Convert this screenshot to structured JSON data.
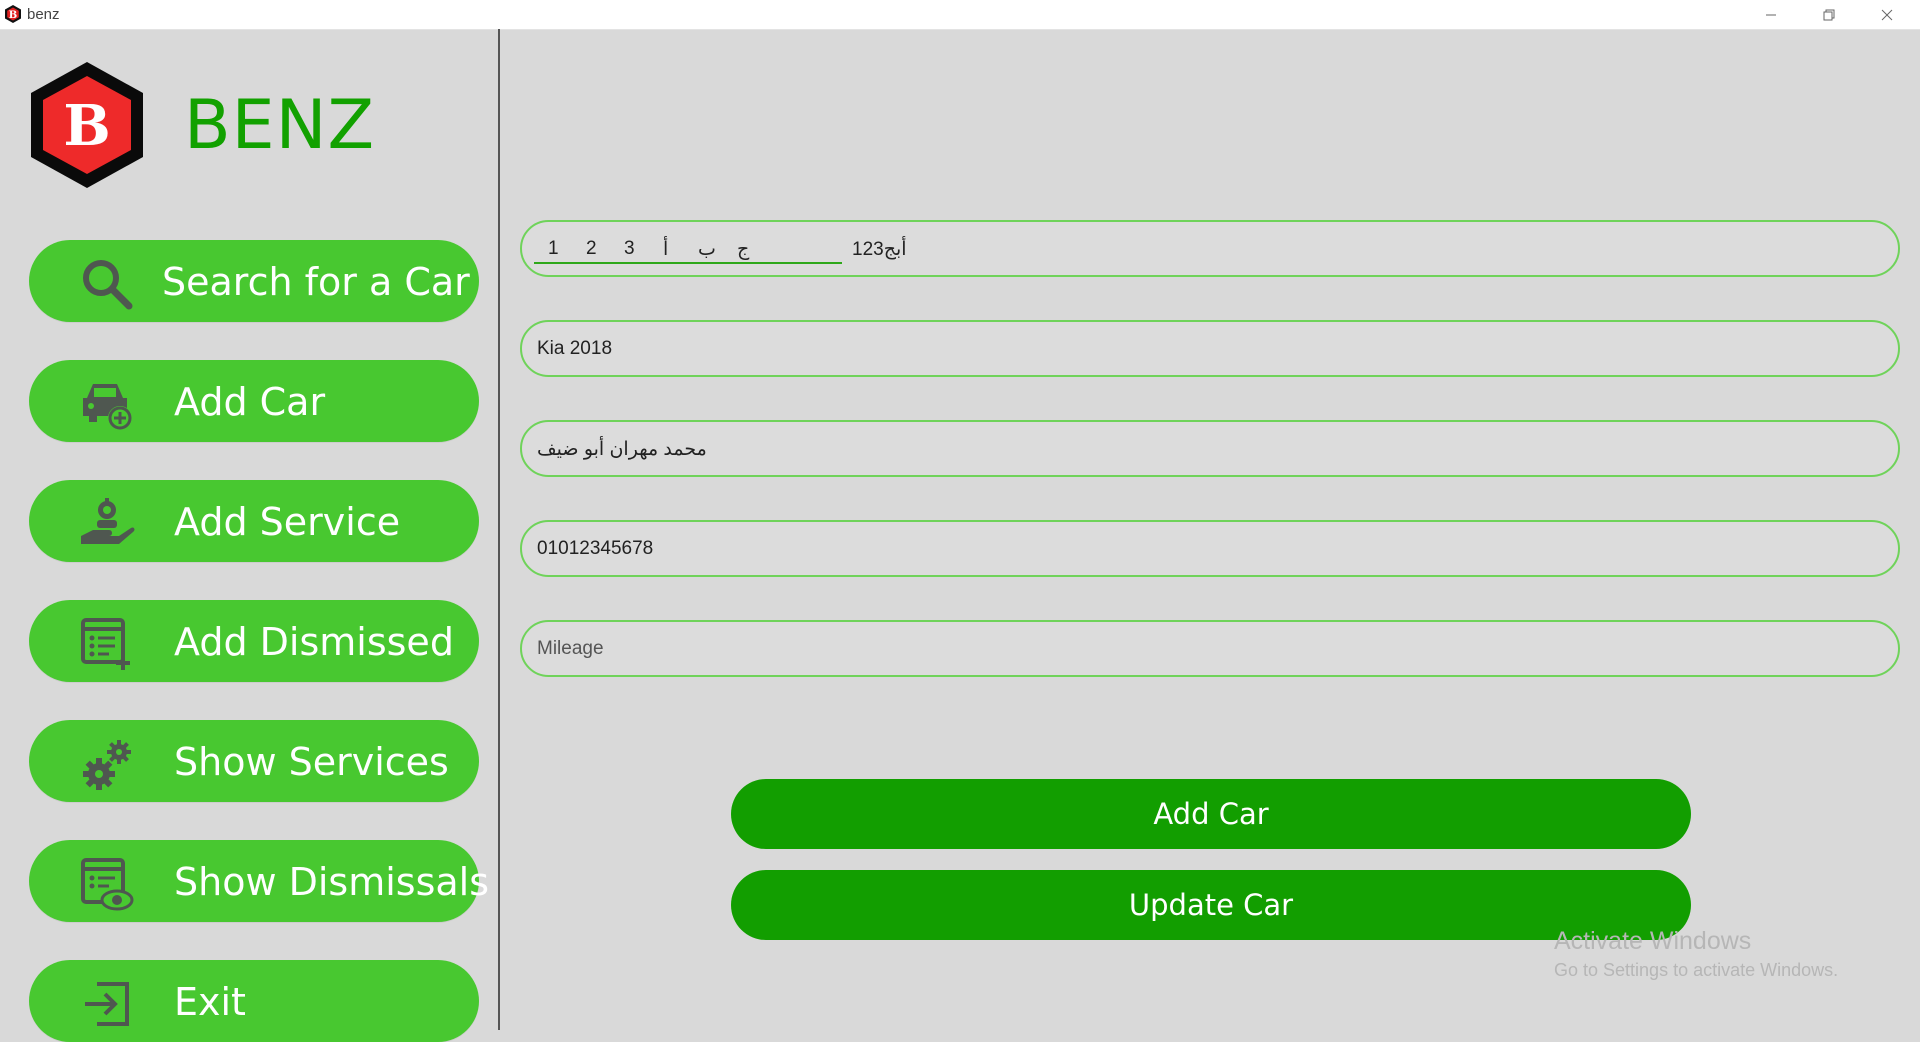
{
  "window": {
    "title": "benz",
    "controls": [
      "minimize-icon",
      "restore-icon",
      "close-icon"
    ]
  },
  "brand": {
    "logo_letter": "B",
    "name": "BENZ"
  },
  "sidebar": {
    "items": [
      {
        "label": "Search for a Car",
        "icon": "search-icon"
      },
      {
        "label": "Add Car",
        "icon": "car-add-icon"
      },
      {
        "label": "Add Service",
        "icon": "service-hand-icon"
      },
      {
        "label": "Add Dismissed",
        "icon": "list-add-icon"
      },
      {
        "label": "Show Services",
        "icon": "gears-icon"
      },
      {
        "label": "Show Dismissals",
        "icon": "list-eye-icon"
      },
      {
        "label": "Exit",
        "icon": "exit-icon"
      }
    ]
  },
  "form": {
    "plate": {
      "chars": [
        "1",
        "2",
        "3",
        "أ",
        "ب",
        "ج"
      ],
      "value": "أبج123"
    },
    "model": {
      "value": "Kia 2018"
    },
    "owner": {
      "value": "محمد مهران أبو ضيف"
    },
    "phone": {
      "value": "01012345678"
    },
    "mileage": {
      "placeholder": "Mileage"
    }
  },
  "actions": {
    "add_label": "Add Car",
    "update_label": "Update Car"
  },
  "watermark": {
    "line1": "Activate Windows",
    "line2": "Go to Settings to activate Windows."
  },
  "colors": {
    "sidebar_button": "#48c830",
    "action_button": "#129e00",
    "brand_text": "#12a100",
    "field_border": "#6fd35a",
    "icon_gray": "#4f5750"
  }
}
